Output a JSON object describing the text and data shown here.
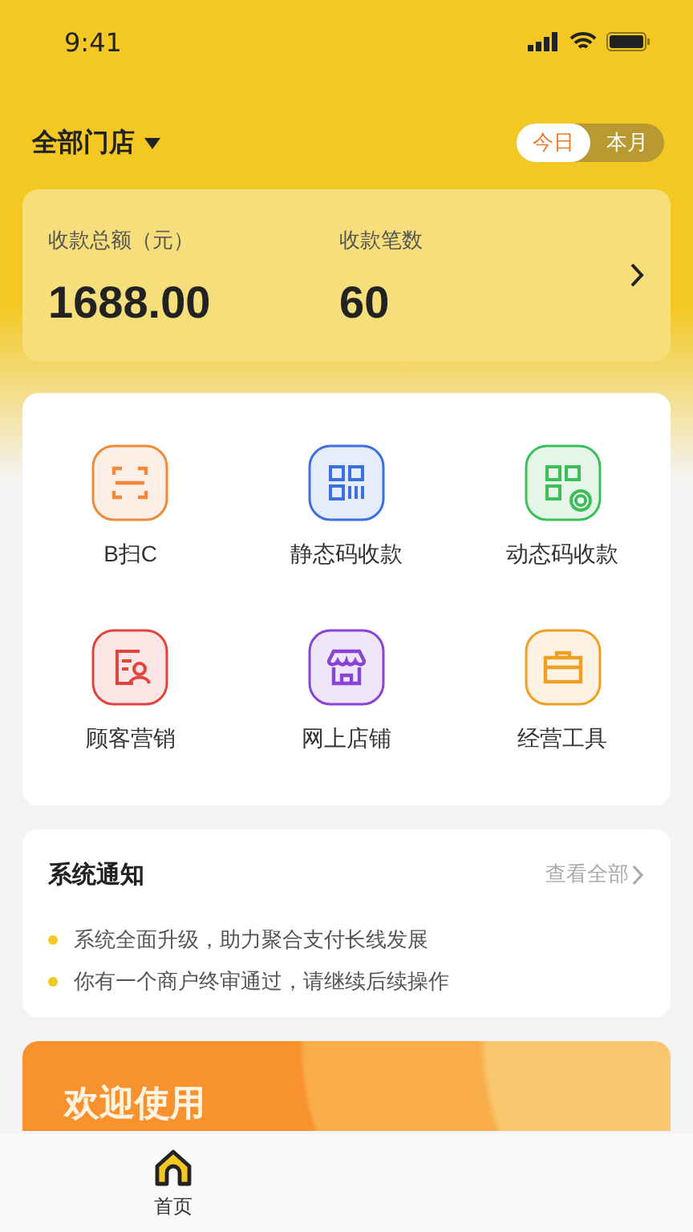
{
  "status_bar": {
    "time": "9:41"
  },
  "header": {
    "store": "全部门店",
    "periods": [
      {
        "label": "今日",
        "selected": true
      },
      {
        "label": "本月",
        "selected": false
      }
    ]
  },
  "summary": {
    "items": [
      {
        "label": "收款总额（元）",
        "value": "1688.00"
      },
      {
        "label": "收款笔数",
        "value": "60"
      }
    ]
  },
  "functions": [
    {
      "label": "B扫C",
      "kind": "scan",
      "color": "#ef8a3a"
    },
    {
      "label": "静态码收款",
      "kind": "qr",
      "color": "#3e6fe0"
    },
    {
      "label": "动态码收款",
      "kind": "dynqr",
      "color": "#3cbf5a"
    },
    {
      "label": "顾客营销",
      "kind": "customer",
      "color": "#e0443c"
    },
    {
      "label": "网上店铺",
      "kind": "shop",
      "color": "#8a44d8"
    },
    {
      "label": "经营工具",
      "kind": "toolbox",
      "color": "#f0a020"
    }
  ],
  "notices": {
    "title": "系统通知",
    "view_all": "查看全部",
    "items": [
      "系统全面升级，助力聚合支付长线发展",
      "你有一个商户终审通过，请继续后续操作"
    ]
  },
  "banner": {
    "title": "欢迎使用"
  },
  "tab_bar": [
    {
      "label": "首页",
      "selected": true
    }
  ]
}
